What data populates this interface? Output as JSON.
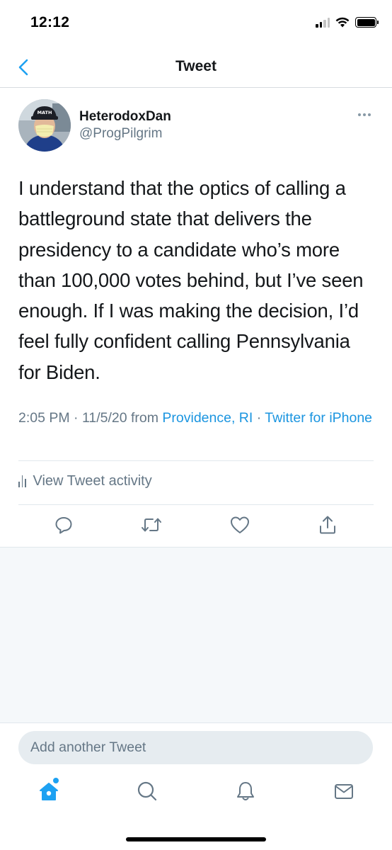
{
  "status_bar": {
    "time": "12:12",
    "signal_bars_active": 2,
    "signal_bars_total": 4
  },
  "header": {
    "title": "Tweet",
    "back_icon": "chevron-left-icon"
  },
  "tweet": {
    "author": {
      "display_name": "HeterodoxDan",
      "handle": "@ProgPilgrim",
      "avatar_cap_text": "MATH"
    },
    "text": "I understand that the optics of calling a battleground state that delivers the presidency to a candidate who’s more than 100,000 votes behind, but I’ve seen enough.  If I was making the decision, I’d feel fully confident calling Pennsylvania for Biden.",
    "timestamp": "2:05 PM · 11/5/20",
    "from_label": " from ",
    "location": "Providence, RI",
    "separator": " · ",
    "source": "Twitter for iPhone",
    "activity_label": "View Tweet activity",
    "actions": [
      {
        "name": "reply",
        "icon": "reply-icon"
      },
      {
        "name": "retweet",
        "icon": "retweet-icon"
      },
      {
        "name": "like",
        "icon": "heart-icon"
      },
      {
        "name": "share",
        "icon": "share-icon"
      }
    ]
  },
  "composer": {
    "placeholder": "Add another Tweet"
  },
  "tab_bar": {
    "tabs": [
      {
        "name": "home",
        "icon": "home-icon",
        "active": true
      },
      {
        "name": "search",
        "icon": "search-icon",
        "active": false
      },
      {
        "name": "notifications",
        "icon": "bell-icon",
        "active": false
      },
      {
        "name": "messages",
        "icon": "mail-icon",
        "active": false
      }
    ]
  },
  "colors": {
    "accent": "#1da1f2",
    "link": "#1b95e0",
    "secondary_text": "#657786",
    "primary_text": "#14171a",
    "background_gray": "#f5f8fa"
  }
}
